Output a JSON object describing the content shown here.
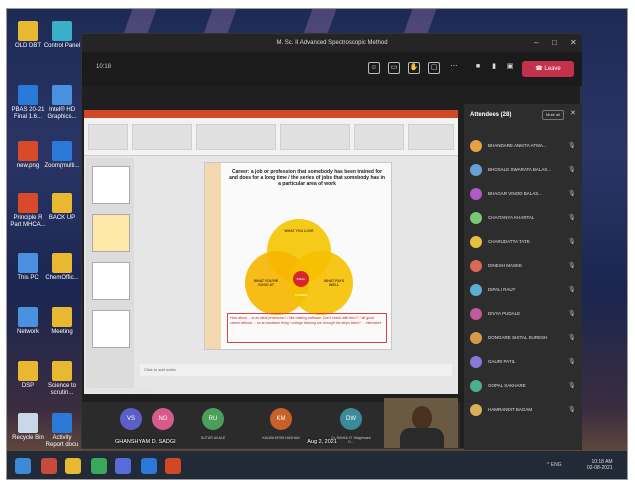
{
  "desktop": {
    "icons": [
      {
        "label": "OLD DBT",
        "icon": "folder-icon"
      },
      {
        "label": "Control Panel",
        "icon": "control-panel-icon"
      },
      {
        "label": "PBAS 20-21 Final 1.6...",
        "icon": "document-icon"
      },
      {
        "label": "Intel® HD Graphics...",
        "icon": "intel-graphics-icon"
      },
      {
        "label": "new.png",
        "icon": "image-icon"
      },
      {
        "label": "Zoom(multi...",
        "icon": "zoom-icon"
      },
      {
        "label": "Principle R Part MHCA...",
        "icon": "pdf-icon"
      },
      {
        "label": "BACK UP",
        "icon": "folder-icon"
      },
      {
        "label": "This PC",
        "icon": "this-pc-icon"
      },
      {
        "label": "ChemOffic...",
        "icon": "folder-icon"
      },
      {
        "label": "Network",
        "icon": "network-icon"
      },
      {
        "label": "Meeting",
        "icon": "folder-icon"
      },
      {
        "label": "DSP",
        "icon": "folder-icon"
      },
      {
        "label": "Science to scrutin...",
        "icon": "folder-icon"
      },
      {
        "label": "Recycle Bin",
        "icon": "recycle-bin-icon"
      },
      {
        "label": "Activity Report docu",
        "icon": "document-icon"
      }
    ]
  },
  "teams": {
    "window_title": "M. Sc. II Advanced Spectroscopic Method",
    "timer": "10:18",
    "leave_label": "Leave",
    "presenter_label": "Dr. Rahul A. Waghmare (Guest)",
    "slide": {
      "heading": "Career: a job or profession that somebody has been trained for and does for a long time / the series of jobs that somebody has in a particular area of work",
      "venn_labels": [
        "WHAT YOU LOVE",
        "WHAT YOU'RE GOOD AT",
        "WHAT PAYS WELL",
        "IDEAL CAREER"
      ],
      "note": "How about ... is an ideal profession? / like making software. Don't check with this?? / all good career without ... so an assistant thing / college thinking are through the steps listed? ... interested",
      "notes_placeholder": "Click to add notes"
    },
    "participants": [
      {
        "initials": "VS",
        "name": "",
        "color": "#5b5fc7"
      },
      {
        "initials": "NG",
        "name": "",
        "color": "#d85a8a"
      },
      {
        "initials": "RU",
        "name": "SUTUR UKALE",
        "color": "#4aa05a"
      },
      {
        "initials": "KM",
        "name": "KALWA KRISH MOHAN",
        "color": "#c8602a"
      },
      {
        "initials": "DW",
        "name": "Dr. RAHUL R. Waghmare D...",
        "color": "#3a8a9a"
      }
    ],
    "attendees": {
      "header": "Attendees (28)",
      "mute_all_label": "Mute all",
      "list": [
        {
          "name": "BHANDARE ANKITA ATMA...",
          "color": "#e8a040"
        },
        {
          "name": "BHOSALE SWARATA BALAS...",
          "color": "#6aa0d8"
        },
        {
          "name": "BHAGAR VINOD BALAS...",
          "color": "#b05ac8"
        },
        {
          "name": "CHAITANYA KHARTAL",
          "color": "#7ac870"
        },
        {
          "name": "CHARUDATTA TATE",
          "color": "#e8c040"
        },
        {
          "name": "DINESH MASKE",
          "color": "#d86a5a"
        },
        {
          "name": "DIPALI RAUT",
          "color": "#5ab0d0"
        },
        {
          "name": "DIVYA PUDALE",
          "color": "#c05a9a"
        },
        {
          "name": "DONGARE SHITAL SURESH",
          "color": "#d8984a"
        },
        {
          "name": "GAURI PATIL",
          "color": "#8a7ad8"
        },
        {
          "name": "GOPAL SAKHARE",
          "color": "#4ab08a"
        },
        {
          "name": "HAMRANDIT BAGAM",
          "color": "#d8b05a"
        }
      ]
    }
  },
  "taskbar": {
    "overlay": "GHANSHYAM D. SADGI",
    "date_overlay": "Aug 2, 2021",
    "time": "10:18 AM",
    "date": "02-08-2021",
    "tray": "^ ENG"
  }
}
